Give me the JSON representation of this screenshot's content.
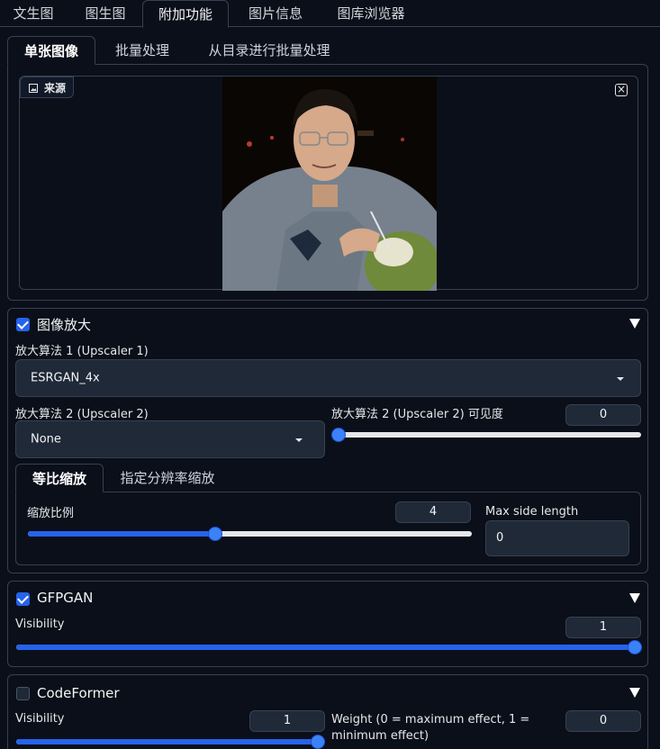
{
  "top_tabs": [
    {
      "label": "文生图"
    },
    {
      "label": "图生图"
    },
    {
      "label": "附加功能"
    },
    {
      "label": "图片信息"
    },
    {
      "label": "图库浏览器"
    }
  ],
  "sub_tabs": [
    {
      "label": "单张图像"
    },
    {
      "label": "批量处理"
    },
    {
      "label": "从目录进行批量处理"
    }
  ],
  "source": {
    "label": "来源",
    "close_glyph": "×"
  },
  "upscale": {
    "title": "图像放大",
    "checked": true,
    "upscaler1_label": "放大算法 1 (Upscaler 1)",
    "upscaler1_value": "ESRGAN_4x",
    "upscaler2_label": "放大算法 2 (Upscaler 2)",
    "upscaler2_value": "None",
    "upscaler2_vis_label": "放大算法 2 (Upscaler 2) 可见度",
    "upscaler2_vis_value": "0",
    "upscaler2_vis_fraction": 0,
    "mode_tabs": [
      {
        "label": "等比缩放"
      },
      {
        "label": "指定分辨率缩放"
      }
    ],
    "scale_label": "缩放比例",
    "scale_value": "4",
    "scale_fraction": 0.42,
    "max_side_label": "Max side length",
    "max_side_value": "0"
  },
  "gfpgan": {
    "title": "GFPGAN",
    "checked": true,
    "visibility_label": "Visibility",
    "visibility_value": "1",
    "visibility_fraction": 1
  },
  "codeformer": {
    "title": "CodeFormer",
    "checked": false,
    "visibility_label": "Visibility",
    "visibility_value": "1",
    "visibility_fraction": 1,
    "weight_label": "Weight (0 = maximum effect, 1 = minimum effect)",
    "weight_value": "0"
  },
  "colors": {
    "accent": "#2563eb",
    "background": "#0b0f19",
    "panel_border": "#374151",
    "input_bg": "#1f2937"
  }
}
